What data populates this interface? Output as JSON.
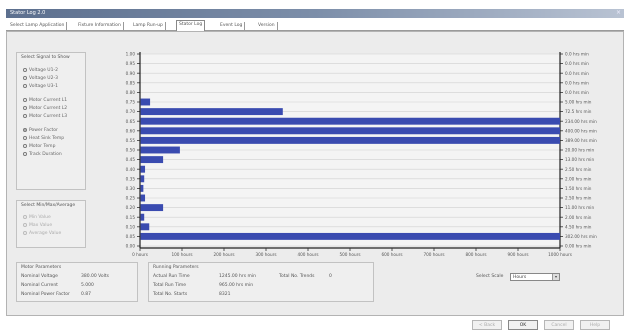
{
  "window": {
    "title": "Stator Log 2.0",
    "close_glyph": "×"
  },
  "tabs": [
    {
      "label": "Select Lamp Application"
    },
    {
      "label": "Fixture Information"
    },
    {
      "label": "Lamp Run-up"
    },
    {
      "label": "Stator Log"
    },
    {
      "label": "Event Log"
    },
    {
      "label": "Version"
    }
  ],
  "signal_group": {
    "title": "Select Signal to Show",
    "options": [
      {
        "label": "Voltage U1-2",
        "checked": false
      },
      {
        "label": "Voltage U2-3",
        "checked": false
      },
      {
        "label": "Voltage U3-1",
        "checked": false
      },
      {
        "label": "Motor Current L1",
        "checked": false
      },
      {
        "label": "Motor Current L2",
        "checked": false
      },
      {
        "label": "Motor Current L3",
        "checked": false
      },
      {
        "label": "Power Factor",
        "checked": true
      },
      {
        "label": "Heat Sink Temp",
        "checked": false
      },
      {
        "label": "Motor Temp",
        "checked": false
      },
      {
        "label": "Track Duration",
        "checked": false
      }
    ]
  },
  "period_group": {
    "title": "Select Min/Max/Average",
    "options": [
      {
        "label": "Min Value",
        "checked": false
      },
      {
        "label": "Max Value",
        "checked": false
      },
      {
        "label": "Average Value",
        "checked": true
      }
    ]
  },
  "chart_data": {
    "type": "bar",
    "orientation": "horizontal",
    "categories": [
      "1.00",
      "0.95",
      "0.90",
      "0.85",
      "0.80",
      "0.75",
      "0.70",
      "0.65",
      "0.60",
      "0.55",
      "0.50",
      "0.45",
      "0.40",
      "0.35",
      "0.30",
      "0.25",
      "0.20",
      "0.15",
      "0.10",
      "0.05",
      "0.00"
    ],
    "values": [
      0,
      0,
      0,
      0,
      0,
      24,
      340,
      1000,
      1000,
      1000,
      95,
      55,
      12,
      10,
      8,
      12,
      55,
      10,
      22,
      1000,
      0
    ],
    "xlim": [
      0,
      1000
    ],
    "x_ticks": [
      "0 hours",
      "100 hours",
      "200 hours",
      "300 hours",
      "400 hours",
      "500 hours",
      "600 hours",
      "700 hours",
      "800 hours",
      "900 hours",
      "1000 hours"
    ],
    "right_labels": [
      "0.0 hrs min",
      "0.0 hrs min",
      "0.0 hrs min",
      "0.0 hrs min",
      "0.0 hrs min",
      "5.00 hrs min",
      "72.5 hrs min",
      "234.00 hrs min",
      "400.00 hrs min",
      "389.00 hrs min",
      "20.00 hrs min",
      "13.00 hrs min",
      "2.50 hrs min",
      "2.00 hrs min",
      "1.50 hrs min",
      "2.50 hrs min",
      "11.00 hrs min",
      "2.00 hrs min",
      "4.50 hrs min",
      "302.00 hrs min",
      "0.00 hrs min"
    ],
    "grid": true,
    "bar_color": "#3a4bb0"
  },
  "motor_params": {
    "title": "Motor Parameters",
    "rows": [
      {
        "label": "Nominal Voltage",
        "value": "380.00 Volts"
      },
      {
        "label": "Nominal Current",
        "value": "5.000"
      },
      {
        "label": "Nominal Power Factor",
        "value": "0.87"
      }
    ]
  },
  "running_params": {
    "title": "Running Parameters",
    "rows": [
      {
        "label": "Actual Run Time",
        "value": "1245.00 hrs min"
      },
      {
        "label": "Total Run Time",
        "value": "965.00 hrs min"
      },
      {
        "label": "Total No. Starts",
        "value": "8321"
      }
    ],
    "extra_label": "Total No. Trends",
    "extra_value": "0"
  },
  "scale": {
    "label": "Select Scale",
    "value": "Hours",
    "arrow": "▾"
  },
  "footer": {
    "buttons": [
      {
        "label": "< Back",
        "enabled": false
      },
      {
        "label": "OK",
        "enabled": true
      },
      {
        "label": "Cancel",
        "enabled": false
      },
      {
        "label": "Help",
        "enabled": false
      }
    ]
  }
}
